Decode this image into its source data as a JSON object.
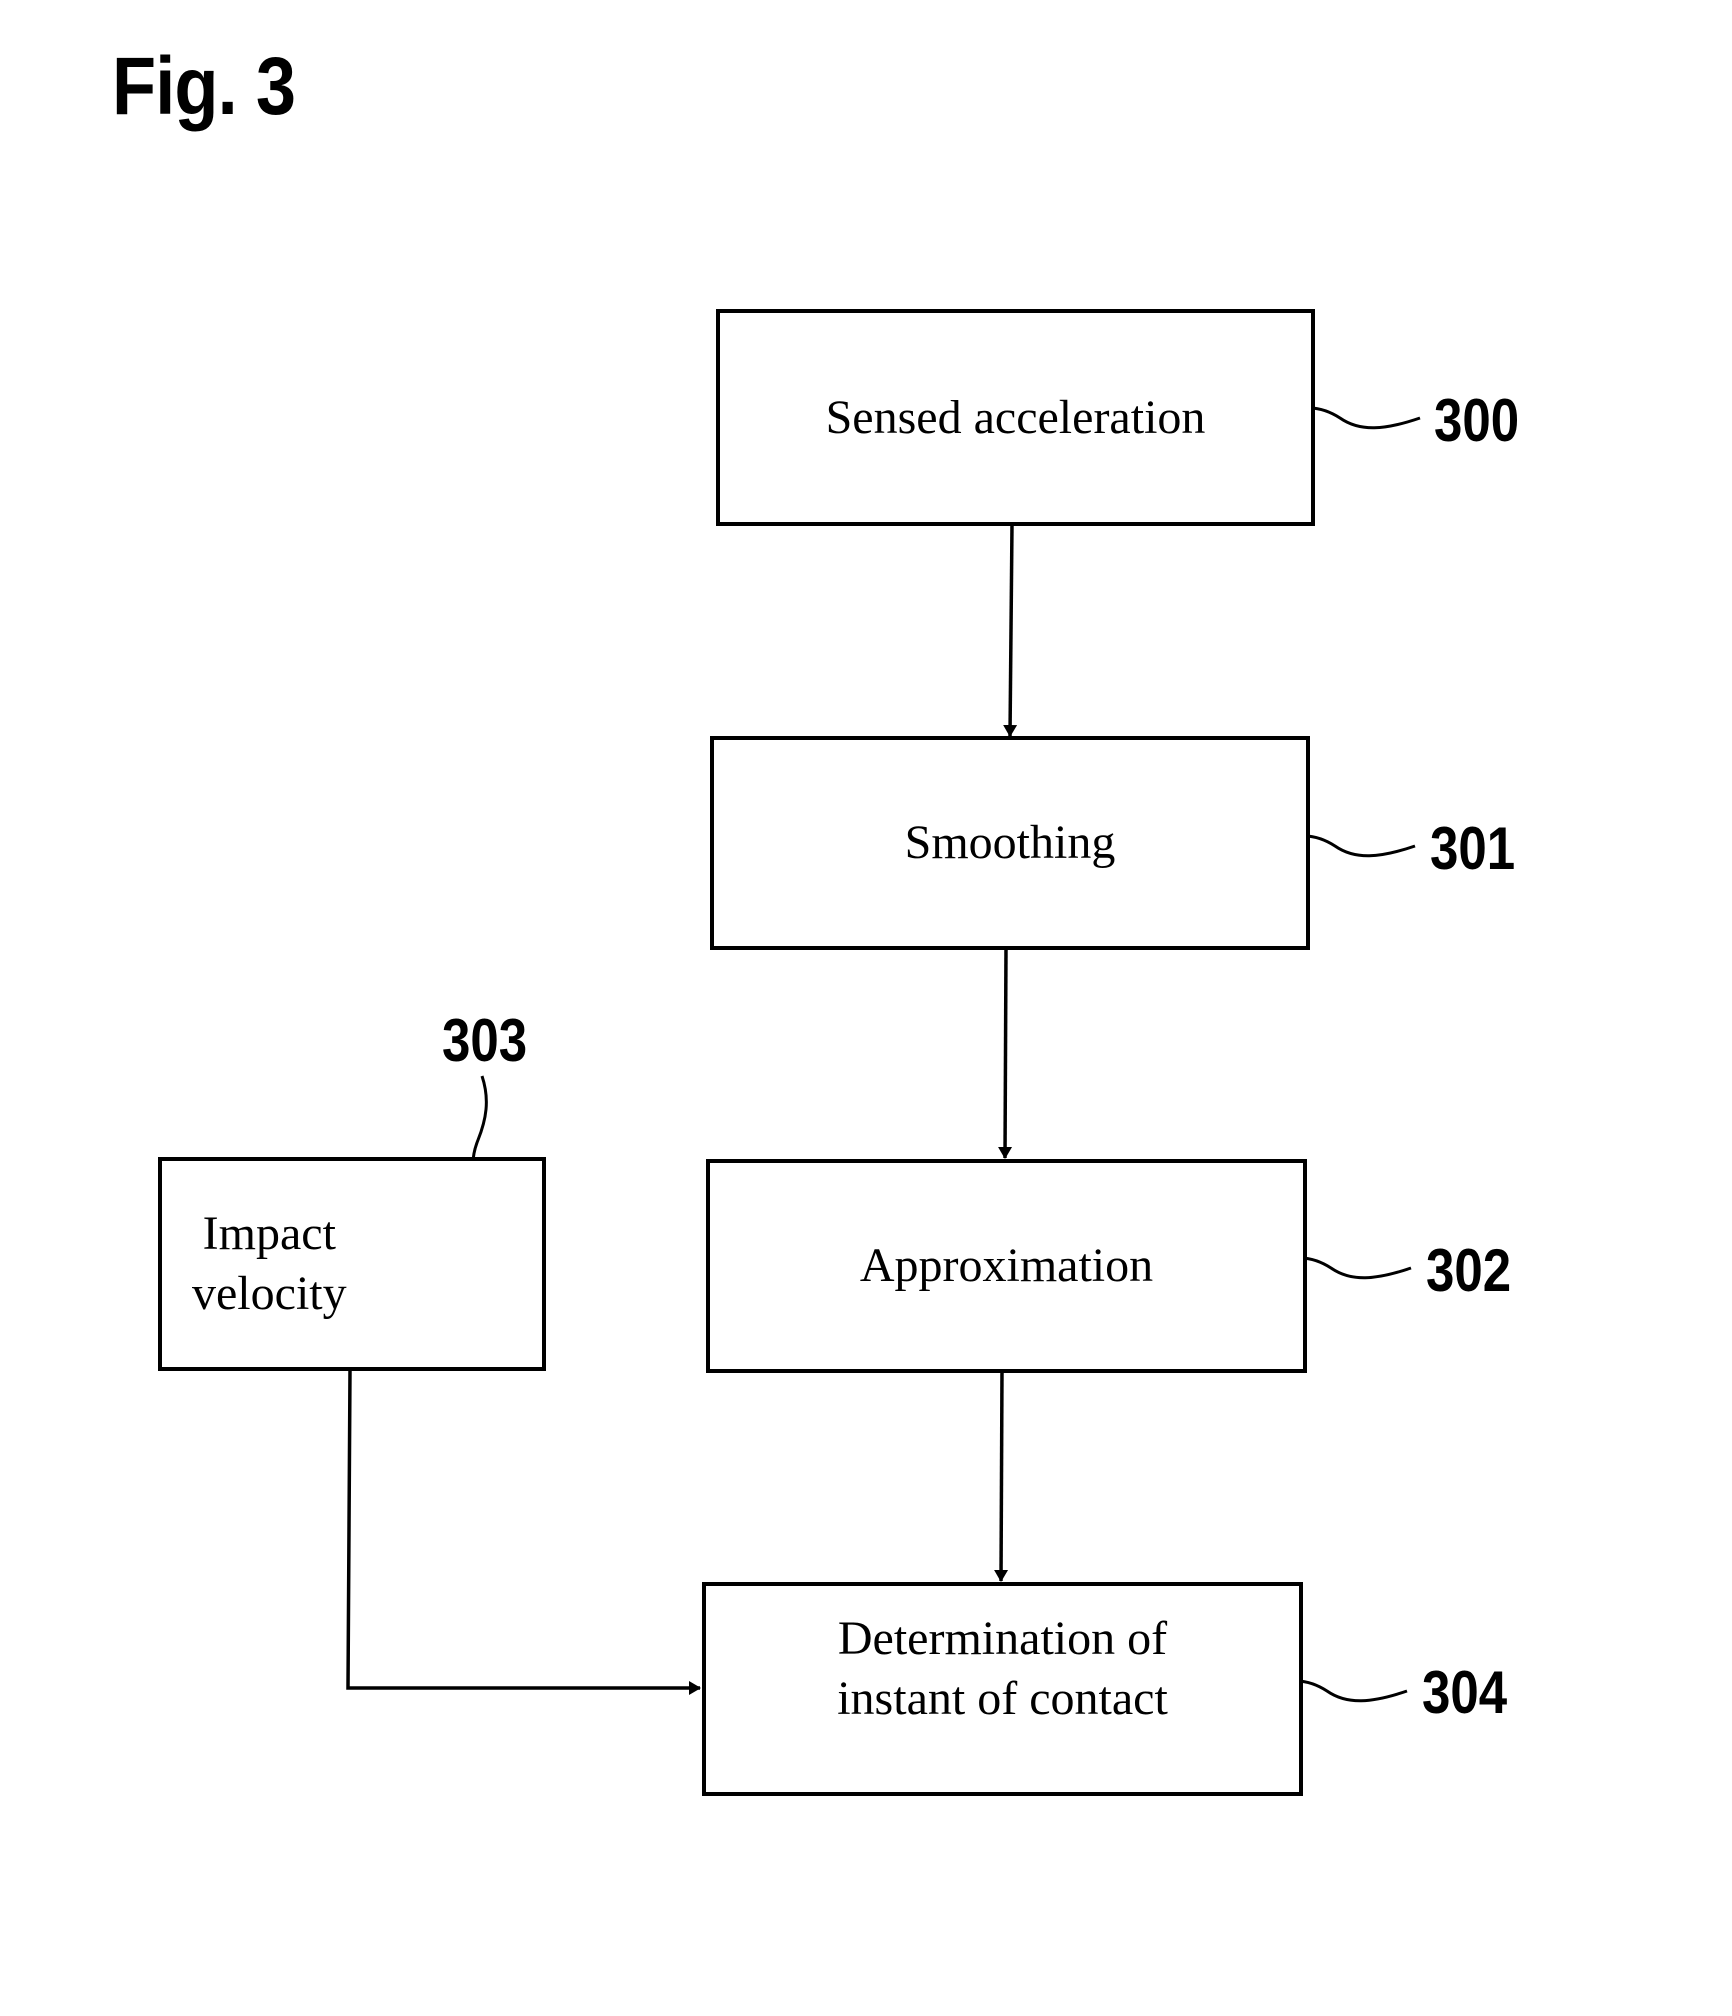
{
  "figure": {
    "title": "Fig. 3"
  },
  "blocks": [
    {
      "id": "300",
      "label": "Sensed acceleration"
    },
    {
      "id": "301",
      "label": "Smoothing"
    },
    {
      "id": "302",
      "label": "Approximation"
    },
    {
      "id": "303",
      "label": "Impact velocity"
    },
    {
      "id": "304",
      "label": "Determination of instant of contact"
    }
  ],
  "block_lines": {
    "303": [
      "Impact",
      "velocity"
    ],
    "304": [
      "Determination of",
      "instant of contact"
    ]
  },
  "edges": [
    {
      "from": "300",
      "to": "301"
    },
    {
      "from": "301",
      "to": "302"
    },
    {
      "from": "302",
      "to": "304"
    },
    {
      "from": "303",
      "to": "304"
    }
  ]
}
